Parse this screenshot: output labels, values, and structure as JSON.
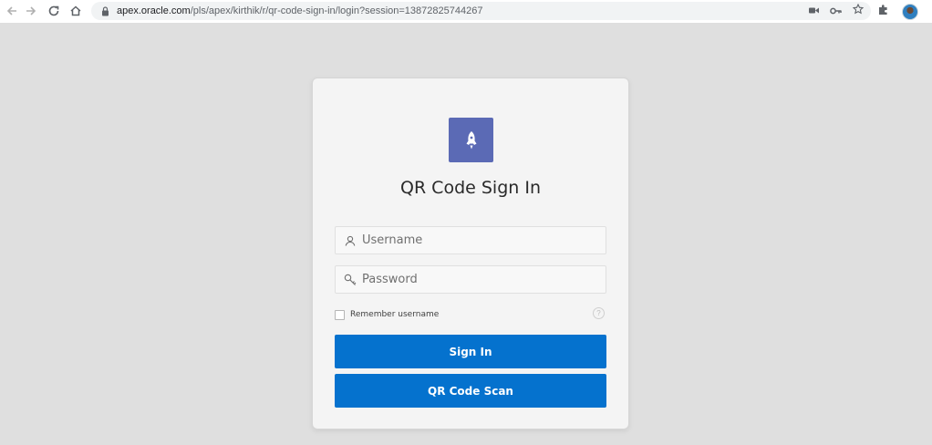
{
  "browser": {
    "url_host": "apex.oracle.com",
    "url_rest": "/pls/apex/kirthik/r/qr-code-sign-in/login?session=13872825744267",
    "icons": [
      "back-icon",
      "forward-icon",
      "reload-icon",
      "home-icon",
      "lock-icon",
      "camera-icon",
      "key-icon",
      "star-icon",
      "extensions-icon",
      "avatar"
    ]
  },
  "login": {
    "title": "QR Code Sign In",
    "username_placeholder": "Username",
    "password_placeholder": "Password",
    "remember_label": "Remember username",
    "help_glyph": "?",
    "sign_in_label": "Sign In",
    "qr_scan_label": "QR Code Scan",
    "app_icon": "rocket-icon"
  },
  "colors": {
    "page_bg": "#dfdfdf",
    "card_bg": "#f4f4f4",
    "primary_button": "#0572ce",
    "app_icon_bg": "#5b6ab5"
  }
}
